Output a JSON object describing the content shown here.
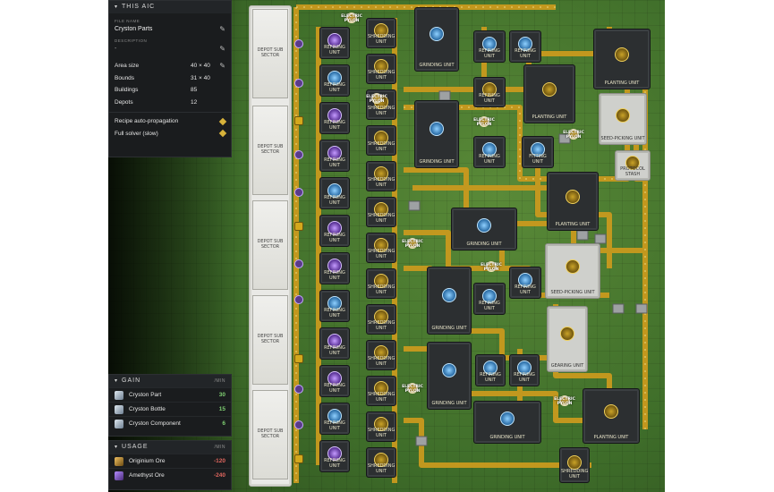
{
  "aic_panel": {
    "title": "THIS AIC",
    "file_name_label": "FILE NAME",
    "file_name_value": "Cryston Parts",
    "description_label": "DESCRIPTION",
    "description_value": "-",
    "area_size": {
      "label": "Area size",
      "value": "40 × 40"
    },
    "bounds": {
      "label": "Bounds",
      "value": "31 × 40"
    },
    "buildings": {
      "label": "Buildings",
      "value": "85"
    },
    "depots": {
      "label": "Depots",
      "value": "12"
    },
    "recipe_auto_propagation": {
      "label": "Recipe auto-propagation"
    },
    "full_solver": {
      "label": "Full solver (slow)"
    }
  },
  "gain_panel": {
    "title": "GAIN",
    "more": "/MIN",
    "items": [
      {
        "name": "Cryston Part",
        "value": "30",
        "icon": "cryston-part-icon",
        "color": "#7fcf72"
      },
      {
        "name": "Cryston Bottle",
        "value": "15",
        "icon": "cryston-bottle-icon",
        "color": "#7fcf72"
      },
      {
        "name": "Cryston Component",
        "value": "6",
        "icon": "cryston-component-icon",
        "color": "#7fcf72"
      }
    ]
  },
  "usage_panel": {
    "title": "USAGE",
    "more": "/MIN",
    "items": [
      {
        "name": "Originium Ore",
        "value": "-120",
        "icon": "originium-ore-icon",
        "color": "#e0665e"
      },
      {
        "name": "Amethyst Ore",
        "value": "-240",
        "icon": "amethyst-ore-icon",
        "color": "#e0665e"
      }
    ]
  },
  "map": {
    "depot_label": "DEPOT SUB SECTOR",
    "refining": "REFINING UNIT",
    "shredding": "SHREDDING UNIT",
    "grinding": "GRINDING UNIT",
    "planting": "PLANTING UNIT",
    "seed_picking": "SEED-PICKING UNIT",
    "fitting": "FITTING UNIT",
    "gearing": "GEARING UNIT",
    "pylon": "ELECTRIC PYLON",
    "protocol_stash": "PROTOCOL STASH",
    "colors": {
      "belt": "#c99a1e",
      "grass": "#4b7a30",
      "building": "#2c2f31",
      "plate": "#e9e9e6"
    }
  }
}
